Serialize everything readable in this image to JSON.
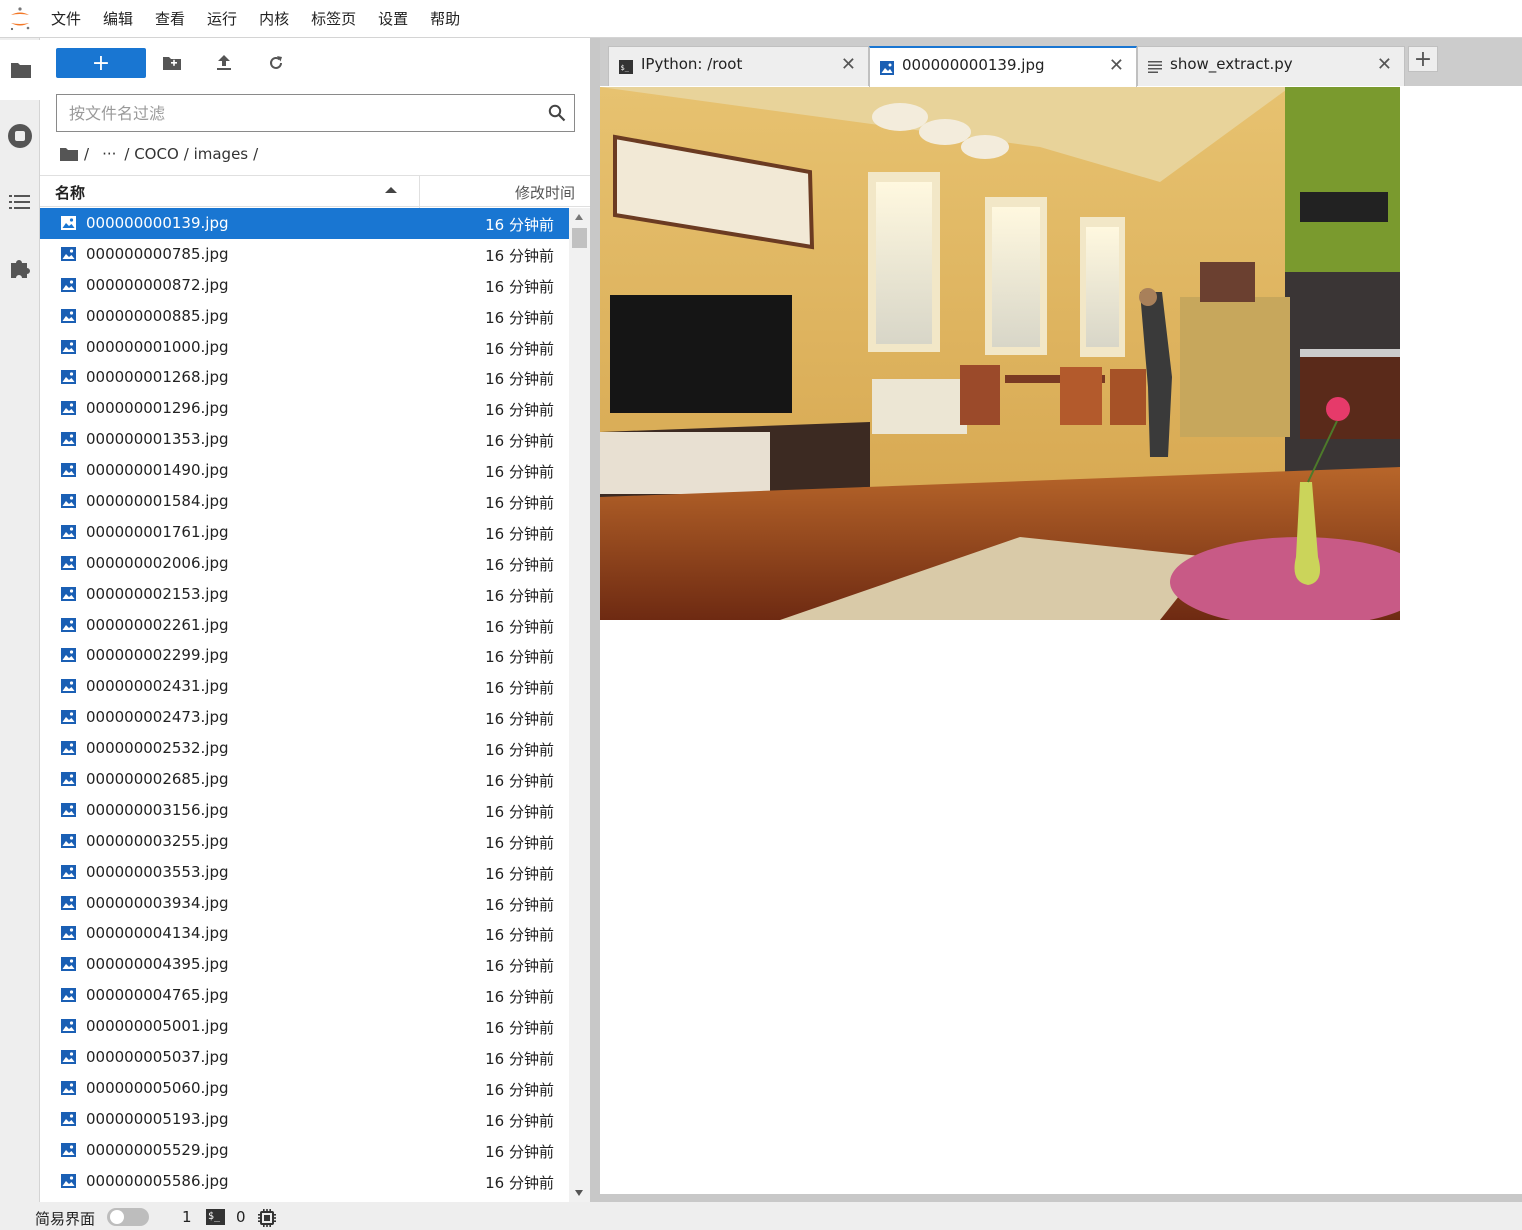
{
  "menu": [
    "文件",
    "编辑",
    "查看",
    "运行",
    "内核",
    "标签页",
    "设置",
    "帮助"
  ],
  "toolbar": {
    "new_label": "+"
  },
  "search": {
    "placeholder": "按文件名过滤",
    "value": ""
  },
  "breadcrumb": {
    "root": "/",
    "ellipsis": "···",
    "parts": [
      "/ COCO",
      "/ images",
      "/"
    ]
  },
  "list_header": {
    "name": "名称",
    "modified": "修改时间"
  },
  "files": [
    {
      "name": "000000000139.jpg",
      "time": "16 分钟前",
      "selected": true
    },
    {
      "name": "000000000785.jpg",
      "time": "16 分钟前"
    },
    {
      "name": "000000000872.jpg",
      "time": "16 分钟前"
    },
    {
      "name": "000000000885.jpg",
      "time": "16 分钟前"
    },
    {
      "name": "000000001000.jpg",
      "time": "16 分钟前"
    },
    {
      "name": "000000001268.jpg",
      "time": "16 分钟前"
    },
    {
      "name": "000000001296.jpg",
      "time": "16 分钟前"
    },
    {
      "name": "000000001353.jpg",
      "time": "16 分钟前"
    },
    {
      "name": "000000001490.jpg",
      "time": "16 分钟前"
    },
    {
      "name": "000000001584.jpg",
      "time": "16 分钟前"
    },
    {
      "name": "000000001761.jpg",
      "time": "16 分钟前"
    },
    {
      "name": "000000002006.jpg",
      "time": "16 分钟前"
    },
    {
      "name": "000000002153.jpg",
      "time": "16 分钟前"
    },
    {
      "name": "000000002261.jpg",
      "time": "16 分钟前"
    },
    {
      "name": "000000002299.jpg",
      "time": "16 分钟前"
    },
    {
      "name": "000000002431.jpg",
      "time": "16 分钟前"
    },
    {
      "name": "000000002473.jpg",
      "time": "16 分钟前"
    },
    {
      "name": "000000002532.jpg",
      "time": "16 分钟前"
    },
    {
      "name": "000000002685.jpg",
      "time": "16 分钟前"
    },
    {
      "name": "000000003156.jpg",
      "time": "16 分钟前"
    },
    {
      "name": "000000003255.jpg",
      "time": "16 分钟前"
    },
    {
      "name": "000000003553.jpg",
      "time": "16 分钟前"
    },
    {
      "name": "000000003934.jpg",
      "time": "16 分钟前"
    },
    {
      "name": "000000004134.jpg",
      "time": "16 分钟前"
    },
    {
      "name": "000000004395.jpg",
      "time": "16 分钟前"
    },
    {
      "name": "000000004765.jpg",
      "time": "16 分钟前"
    },
    {
      "name": "000000005001.jpg",
      "time": "16 分钟前"
    },
    {
      "name": "000000005037.jpg",
      "time": "16 分钟前"
    },
    {
      "name": "000000005060.jpg",
      "time": "16 分钟前"
    },
    {
      "name": "000000005193.jpg",
      "time": "16 分钟前"
    },
    {
      "name": "000000005529.jpg",
      "time": "16 分钟前"
    },
    {
      "name": "000000005586.jpg",
      "time": "16 分钟前"
    }
  ],
  "tabs": [
    {
      "label": "IPython: /root",
      "icon": "terminal-icon",
      "close": "✕"
    },
    {
      "label": "000000000139.jpg",
      "icon": "image-icon",
      "close": "✕",
      "active": true
    },
    {
      "label": "show_extract.py",
      "icon": "text-file-icon",
      "close": "✕"
    }
  ],
  "add_tab": "+",
  "status": {
    "simple_mode": "简易界面",
    "kernels": "1",
    "terminal_icon_text": "$_",
    "terminals": "0"
  },
  "colors": {
    "accent": "#1976d2",
    "file_icon": "#1a5fb4"
  }
}
